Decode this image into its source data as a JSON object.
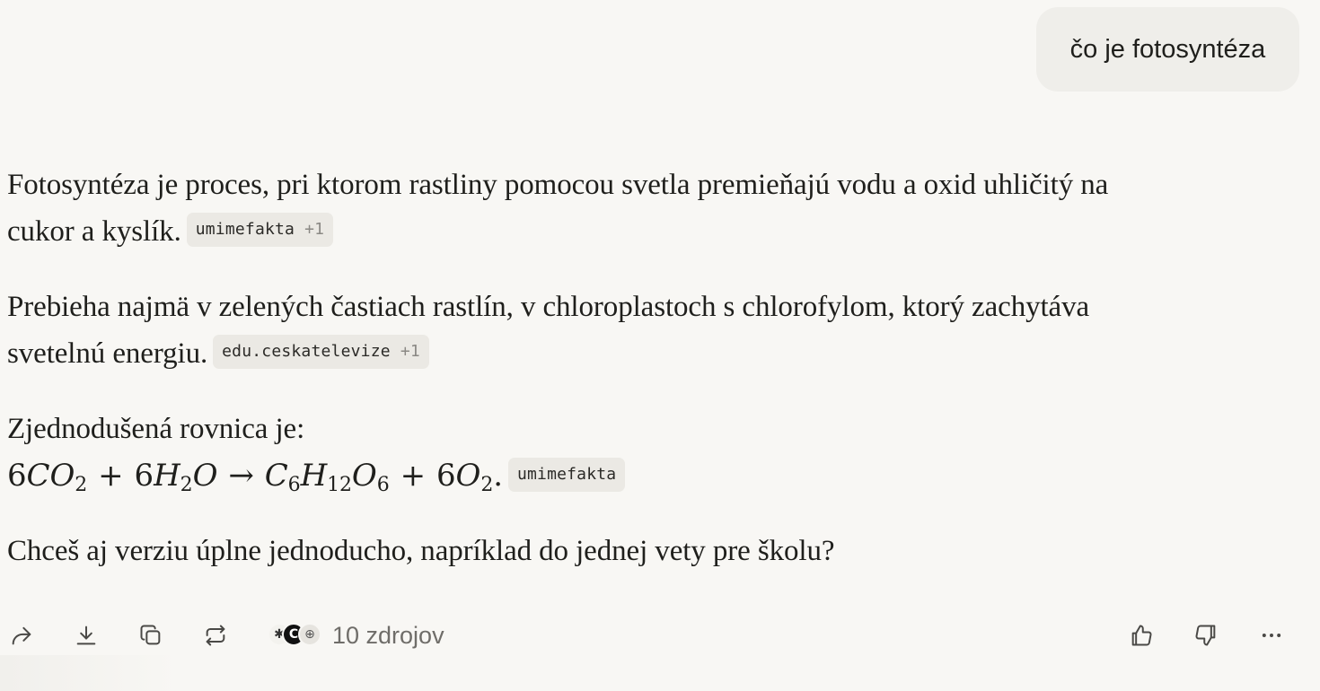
{
  "user_message": "čo je fotosyntéza",
  "answer": {
    "p1": {
      "line1": "Fotosyntéza je proces, pri ktorom rastliny pomocou svetla premieňajú vodu a oxid uhličitý na",
      "line2": "cukor a kyslík.",
      "chip": {
        "label": "umimefakta",
        "more": "+1"
      }
    },
    "p2": {
      "line1": "Prebieha najmä v zelených častiach rastlín, v chloroplastoch s chlorofylom, ktorý zachytáva",
      "line2": "svetelnú energiu.",
      "chip": {
        "label": "edu.ceskatelevize",
        "more": "+1"
      }
    },
    "p3": {
      "line1": "Zjednodušená rovnica je:",
      "equation": {
        "coef1": "6",
        "co": "CO",
        "sub2a": "2",
        "plus1": "+",
        "coef2": "6",
        "h": "H",
        "sub2b": "2",
        "o1": "O",
        "arrow": "→",
        "c": "C",
        "sub6a": "6",
        "h2": "H",
        "sub12": "12",
        "o2": "O",
        "sub6b": "6",
        "plus2": "+",
        "coef3": "6",
        "o3": "O",
        "sub2c": "2",
        "dot": "."
      },
      "chip": {
        "label": "umimefakta"
      }
    },
    "p4": {
      "line1": "Chceš aj verziu úplne jednoducho, napríklad do jednej vety pre školu?"
    }
  },
  "toolbar": {
    "sources_label": "10 zdrojov",
    "icons": [
      "share-icon",
      "download-icon",
      "copy-icon",
      "rewrite-icon",
      "thumbs-up-icon",
      "thumbs-down-icon",
      "more-icon"
    ]
  },
  "colors": {
    "background": "#f8f7f4",
    "bubble": "#efeeea",
    "chip": "#ebe9e4",
    "icon": "#6f6d69"
  }
}
